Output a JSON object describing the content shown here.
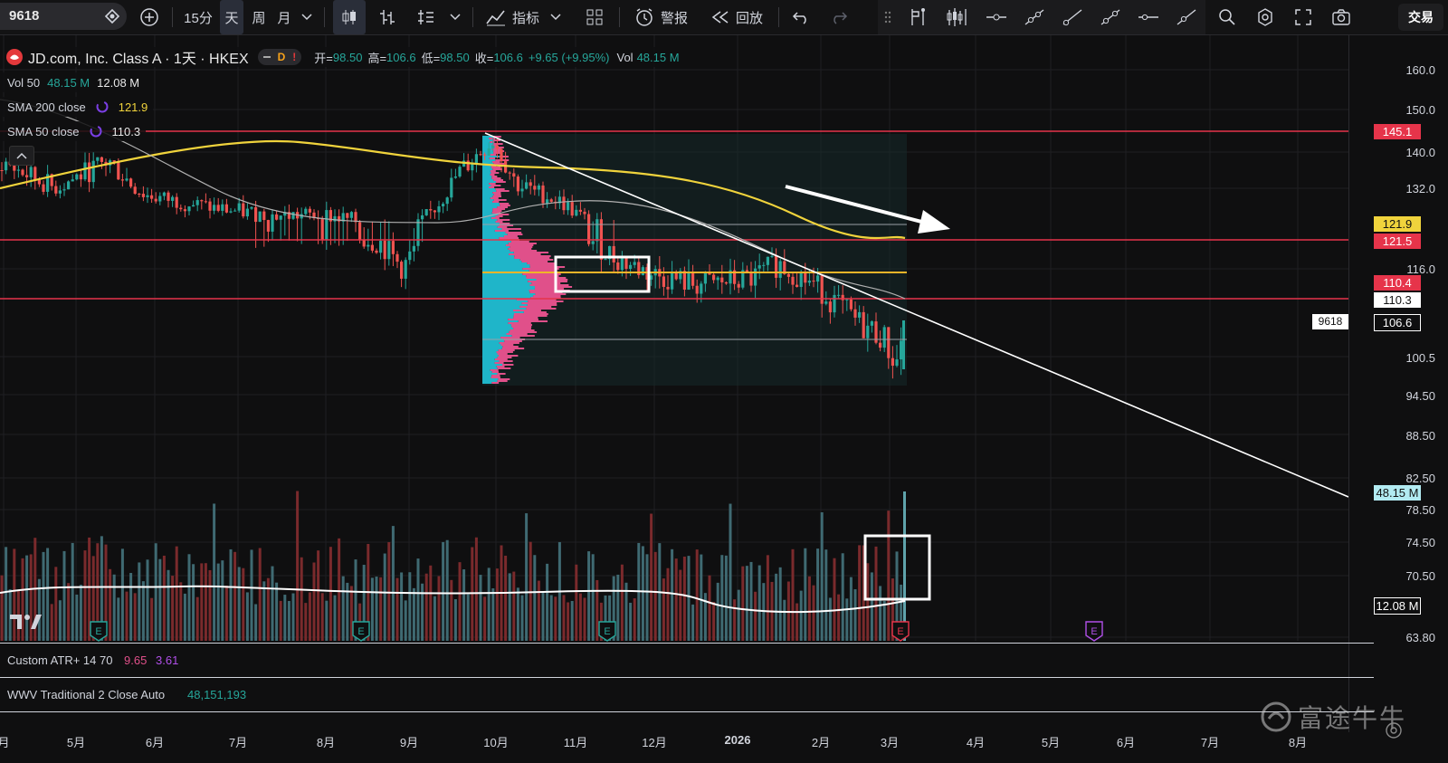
{
  "toolbar": {
    "symbol": "9618",
    "intervals": [
      "15分",
      "天",
      "周",
      "月"
    ],
    "active_interval": "天",
    "indicators_label": "指标",
    "alerts_label": "警报",
    "replay_label": "回放",
    "trade_label": "交易"
  },
  "legend": {
    "title": "JD.com, Inc. Class A · 1天 · HKEX",
    "badge": "D",
    "open_label": "开=",
    "open": "98.50",
    "high_label": "高=",
    "high": "106.6",
    "low_label": "低=",
    "low": "98.50",
    "close_label": "收=",
    "close": "106.6",
    "change": "+9.65 (+9.95%)",
    "vol_label": "Vol",
    "vol": "48.15 M",
    "studies": [
      {
        "name": "Vol 50",
        "v1": "48.15 M",
        "v2": "12.08 M"
      },
      {
        "name": "SMA 200 close",
        "v1": "121.9"
      },
      {
        "name": "SMA 50 close",
        "v1": "110.3"
      }
    ]
  },
  "price_axis": [
    "160.0",
    "150.0",
    "140.0",
    "132.0",
    "116.0",
    "100.5",
    "94.50",
    "88.50",
    "82.50",
    "78.50",
    "74.50",
    "70.50",
    "63.80"
  ],
  "price_tags": {
    "hline_top": "145.1",
    "sma200": "121.9",
    "hline_mid": "121.5",
    "hline_low": "110.4",
    "sma50": "110.3",
    "symbol": "9618",
    "last": "106.6",
    "vol": "48.15 M",
    "vol_ma": "12.08 M"
  },
  "time_axis": [
    "月",
    "5月",
    "6月",
    "7月",
    "8月",
    "9月",
    "10月",
    "11月",
    "12月",
    "2026",
    "2月",
    "3月",
    "4月",
    "5月",
    "6月",
    "7月",
    "8月"
  ],
  "panels": [
    {
      "name": "Custom ATR+ 14 70",
      "v1": "9.65",
      "v2": "3.61"
    },
    {
      "name": "WWV Traditional 2 Close Auto",
      "v1": "48,151,193"
    }
  ],
  "watermark": "富途牛牛",
  "earnings_marker": "E",
  "colors": {
    "up": "#26a69a",
    "down": "#ef5350",
    "sma200": "#f0d33c",
    "hline": "#e6344a",
    "profile_up": "#1fb5c9",
    "profile_down": "#e0508a",
    "bg": "#0f0f10"
  }
}
